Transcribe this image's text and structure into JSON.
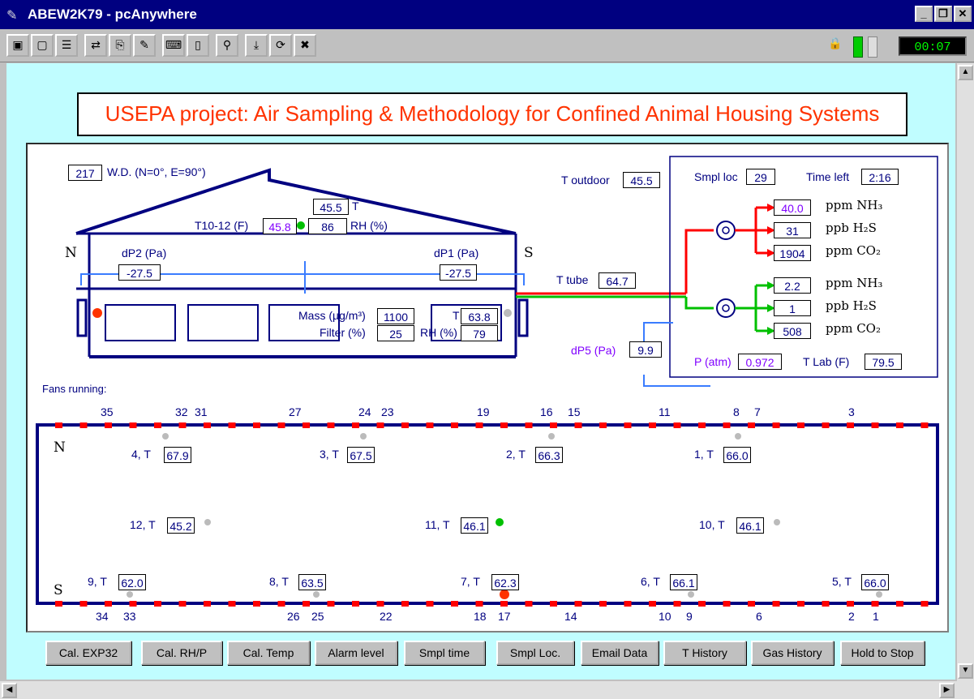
{
  "window": {
    "title": "ABEW2K79 - pcAnywhere",
    "timer": "00:07"
  },
  "headline": "USEPA project: Air Sampling & Methodology for Confined Animal Housing Systems",
  "barn": {
    "wd_value": "217",
    "wd_label": "W.D. (N=0°, E=90°)",
    "t_value": "45.5",
    "t_label": "T",
    "t1012_label": "T10-12 (F)",
    "t1012_value": "45.8",
    "rh_value": "86",
    "rh_label": "RH (%)",
    "north": "N",
    "south": "S",
    "dp2_label": "dP2 (Pa)",
    "dp2_value": "-27.5",
    "dp1_label": "dP1 (Pa)",
    "dp1_value": "-27.5",
    "mass_label": "Mass (µg/m³)",
    "mass_value": "1100",
    "filter_label": "Filter (%)",
    "filter_value": "25",
    "t_inner_label": "T",
    "t_inner_value": "63.8",
    "rh_inner_label": "RH (%)",
    "rh_inner_value": "79"
  },
  "outdoor": {
    "t_outdoor_label": "T outdoor",
    "t_outdoor_value": "45.5",
    "t_tube_label": "T tube",
    "t_tube_value": "64.7",
    "dp5_label": "dP5 (Pa)",
    "dp5_value": "9.9"
  },
  "lab": {
    "smpl_loc_label": "Smpl loc",
    "smpl_loc_value": "29",
    "time_left_label": "Time left",
    "time_left_value": "2:16",
    "red": [
      {
        "value": "40.0",
        "unit": "ppm NH₃"
      },
      {
        "value": "31",
        "unit": "ppb H₂S"
      },
      {
        "value": "1904",
        "unit": "ppm CO₂"
      }
    ],
    "green": [
      {
        "value": "2.2",
        "unit": "ppm NH₃"
      },
      {
        "value": "1",
        "unit": "ppb H₂S"
      },
      {
        "value": "508",
        "unit": "ppm CO₂"
      }
    ],
    "p_atm_label": "P (atm)",
    "p_atm_value": "0.972",
    "t_lab_label": "T Lab (F)",
    "t_lab_value": "79.5"
  },
  "fans_running_label": "Fans running:",
  "fans_top": [
    "35",
    "32",
    "31",
    "27",
    "24",
    "23",
    "19",
    "16",
    "15",
    "11",
    "8",
    "7",
    "3"
  ],
  "fans_bottom": [
    "34",
    "33",
    "26",
    "25",
    "22",
    "18",
    "17",
    "14",
    "10",
    "9",
    "6",
    "2",
    "1"
  ],
  "plan": {
    "north": "N",
    "south": "S",
    "sensors": [
      {
        "label": "4, T",
        "value": "67.9"
      },
      {
        "label": "3, T",
        "value": "67.5"
      },
      {
        "label": "2, T",
        "value": "66.3"
      },
      {
        "label": "1, T",
        "value": "66.0"
      },
      {
        "label": "12, T",
        "value": "45.2"
      },
      {
        "label": "11, T",
        "value": "46.1"
      },
      {
        "label": "10, T",
        "value": "46.1"
      },
      {
        "label": "9, T",
        "value": "62.0"
      },
      {
        "label": "8, T",
        "value": "63.5"
      },
      {
        "label": "7, T",
        "value": "62.3"
      },
      {
        "label": "6, T",
        "value": "66.1"
      },
      {
        "label": "5, T",
        "value": "66.0"
      }
    ]
  },
  "buttons": [
    "Cal. EXP32",
    "Cal. RH/P",
    "Cal. Temp",
    "Alarm level",
    "Smpl time",
    "Smpl Loc.",
    "Email Data",
    "T History",
    "Gas History",
    "Hold to Stop"
  ],
  "colors": {
    "navy": "#000080",
    "purple": "#8000ff",
    "alarm_red": "#ff0000",
    "ok_green": "#00c000",
    "headline_red": "#ff3300",
    "client_bg": "#c0fdff"
  }
}
